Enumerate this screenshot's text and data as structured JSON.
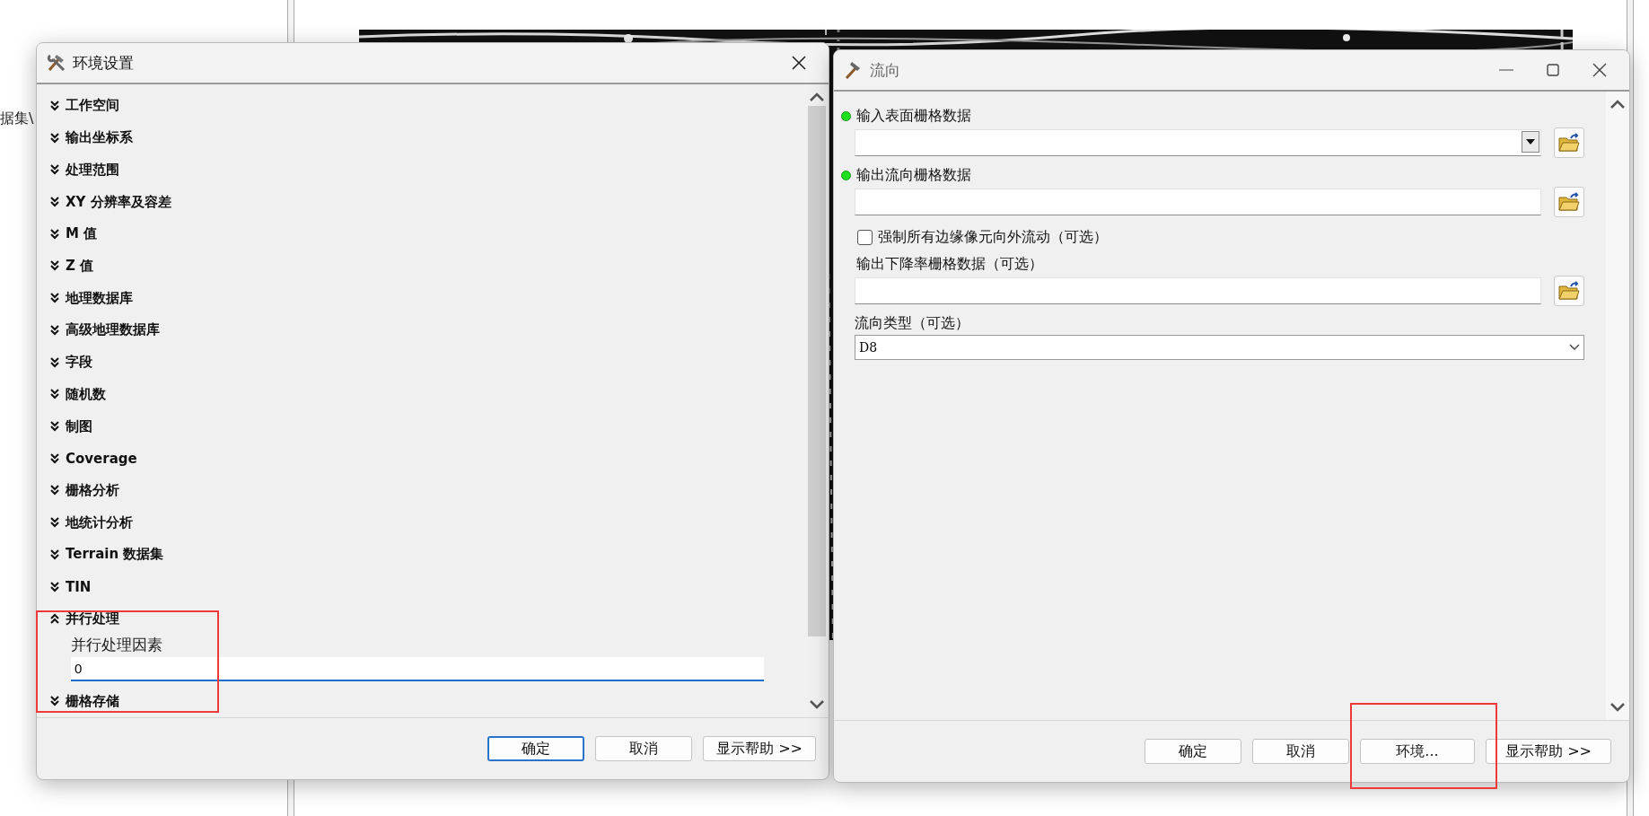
{
  "background": {
    "path_fragment": "据集\\"
  },
  "environment_dialog": {
    "title": "环境设置",
    "sections": [
      {
        "label": "工作空间",
        "expanded": false
      },
      {
        "label": "输出坐标系",
        "expanded": false
      },
      {
        "label": "处理范围",
        "expanded": false
      },
      {
        "label": "XY 分辨率及容差",
        "expanded": false
      },
      {
        "label": "M 值",
        "expanded": false
      },
      {
        "label": "Z 值",
        "expanded": false
      },
      {
        "label": "地理数据库",
        "expanded": false
      },
      {
        "label": "高级地理数据库",
        "expanded": false
      },
      {
        "label": "字段",
        "expanded": false
      },
      {
        "label": "随机数",
        "expanded": false
      },
      {
        "label": "制图",
        "expanded": false
      },
      {
        "label": "Coverage",
        "expanded": false
      },
      {
        "label": "栅格分析",
        "expanded": false
      },
      {
        "label": "地统计分析",
        "expanded": false
      },
      {
        "label": "Terrain 数据集",
        "expanded": false
      },
      {
        "label": "TIN",
        "expanded": false
      },
      {
        "label": "并行处理",
        "expanded": true,
        "fields": [
          {
            "label": "并行处理因素",
            "value": "0"
          }
        ]
      },
      {
        "label": "栅格存储",
        "expanded": false
      }
    ],
    "buttons": [
      {
        "label": "确定",
        "default": true
      },
      {
        "label": "取消",
        "default": false
      },
      {
        "label": "显示帮助 >>",
        "default": false
      }
    ]
  },
  "tool_dialog": {
    "title": "流向",
    "parameters": [
      {
        "kind": "dropdown-path",
        "label": "输入表面栅格数据",
        "required": true
      },
      {
        "kind": "path",
        "label": "输出流向栅格数据",
        "required": true
      },
      {
        "kind": "checkbox",
        "label": "强制所有边缘像元向外流动（可选）",
        "checked": false
      },
      {
        "kind": "path",
        "label": "输出下降率栅格数据（可选）",
        "required": false
      },
      {
        "kind": "select",
        "label": "流向类型（可选）",
        "value": "D8"
      }
    ],
    "buttons": [
      {
        "label": "确定",
        "default": false
      },
      {
        "label": "取消",
        "default": false
      },
      {
        "label": "环境...",
        "default": false
      },
      {
        "label": "显示帮助 >>",
        "default": false
      }
    ]
  }
}
